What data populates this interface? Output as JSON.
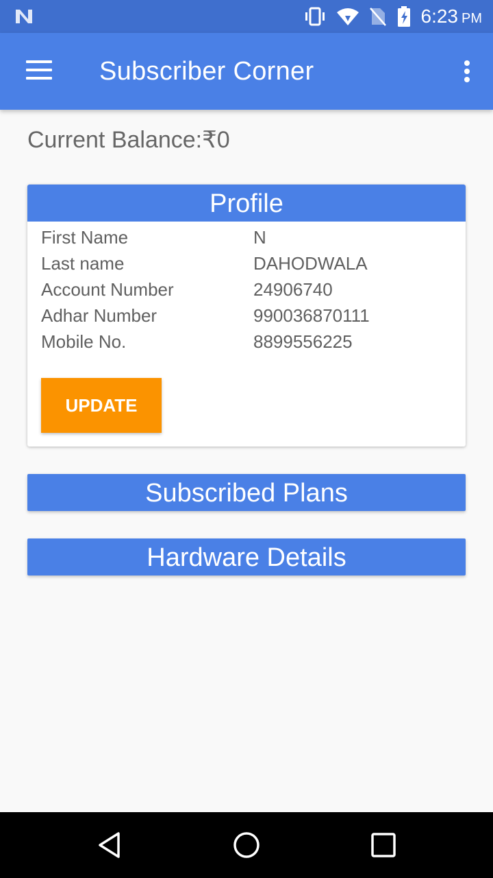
{
  "status_bar": {
    "time": "6:23",
    "ampm": "PM",
    "icons": [
      "n-logo-icon",
      "vibrate-icon",
      "wifi-icon",
      "no-sim-icon",
      "battery-charging-icon"
    ]
  },
  "app_bar": {
    "title": "Subscriber Corner",
    "menu_icon": "hamburger-menu-icon",
    "overflow_icon": "overflow-menu-icon"
  },
  "balance": {
    "text": "Current Balance:₹0"
  },
  "profile": {
    "header": "Profile",
    "rows": [
      {
        "label": "First Name",
        "value": "N"
      },
      {
        "label": "Last name",
        "value": "DAHODWALA"
      },
      {
        "label": "Account Number",
        "value": "24906740"
      },
      {
        "label": "Adhar Number",
        "value": "990036870111"
      },
      {
        "label": "Mobile No.",
        "value": "8899556225"
      }
    ],
    "update_label": "UPDATE"
  },
  "sections": {
    "subscribed_plans": "Subscribed Plans",
    "hardware_details": "Hardware Details"
  },
  "nav_bar": {
    "icons": [
      "back-icon",
      "home-icon",
      "recents-icon"
    ]
  },
  "colors": {
    "status_bar": "#3f6fce",
    "primary": "#4a80e6",
    "accent": "#fb9300",
    "background": "#f9f9f9"
  }
}
